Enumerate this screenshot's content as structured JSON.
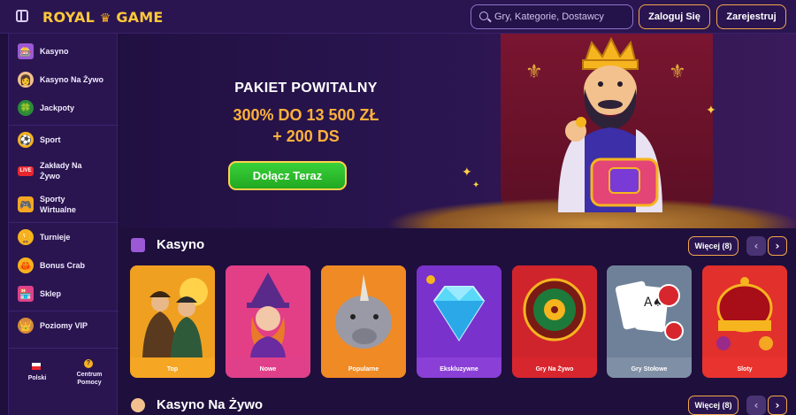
{
  "header": {
    "logo_text": "ROYAL",
    "logo_text2": "GAME",
    "search_placeholder": "Gry, Kategorie, Dostawcy",
    "login_label": "Zaloguj Się",
    "register_label": "Zarejestruj"
  },
  "sidebar": {
    "items": [
      {
        "label": "Kasyno",
        "icon": "slot-machine-icon"
      },
      {
        "label": "Kasyno Na Żywo",
        "icon": "dealer-icon"
      },
      {
        "label": "Jackpoty",
        "icon": "clover-icon"
      },
      {
        "label": "Sport",
        "icon": "ball-icon"
      },
      {
        "label": "Zakłady Na Żywo",
        "icon": "live-icon",
        "badge": "LIVE"
      },
      {
        "label": "Sporty Wirtualne",
        "icon": "gamepad-icon"
      },
      {
        "label": "Turnieje",
        "icon": "trophy-icon"
      },
      {
        "label": "Bonus Crab",
        "icon": "crab-icon"
      },
      {
        "label": "Sklep",
        "icon": "shop-icon"
      },
      {
        "label": "Poziomy VIP",
        "icon": "vip-icon"
      }
    ],
    "language_label": "Polski",
    "help_label": "Centrum Pomocy"
  },
  "banner": {
    "title": "PAKIET POWITALNY",
    "line1": "300% DO 13 500 ZŁ",
    "line2": "+ 200 DS",
    "cta_label": "Dołącz Teraz"
  },
  "sections": [
    {
      "title": "Kasyno",
      "more_label": "Więcej (8)"
    },
    {
      "title": "Kasyno Na Żywo",
      "more_label": "Więcej (8)"
    }
  ],
  "categories": [
    {
      "label": "Top",
      "color": "#f5a623"
    },
    {
      "label": "Nowe",
      "color": "#e0408a"
    },
    {
      "label": "Popularne",
      "color": "#f08a24"
    },
    {
      "label": "Ekskluzywne",
      "color": "#8a3fd6"
    },
    {
      "label": "Gry Na Żywo",
      "color": "#d8262e"
    },
    {
      "label": "Gry Stołowe",
      "color": "#7f8fa6"
    },
    {
      "label": "Sloty",
      "color": "#e8332f"
    }
  ],
  "colors": {
    "accent": "#f3a64a",
    "gold": "#ffb13a",
    "cta_green": "#2fbf2f",
    "bg": "#1e0f3c"
  }
}
